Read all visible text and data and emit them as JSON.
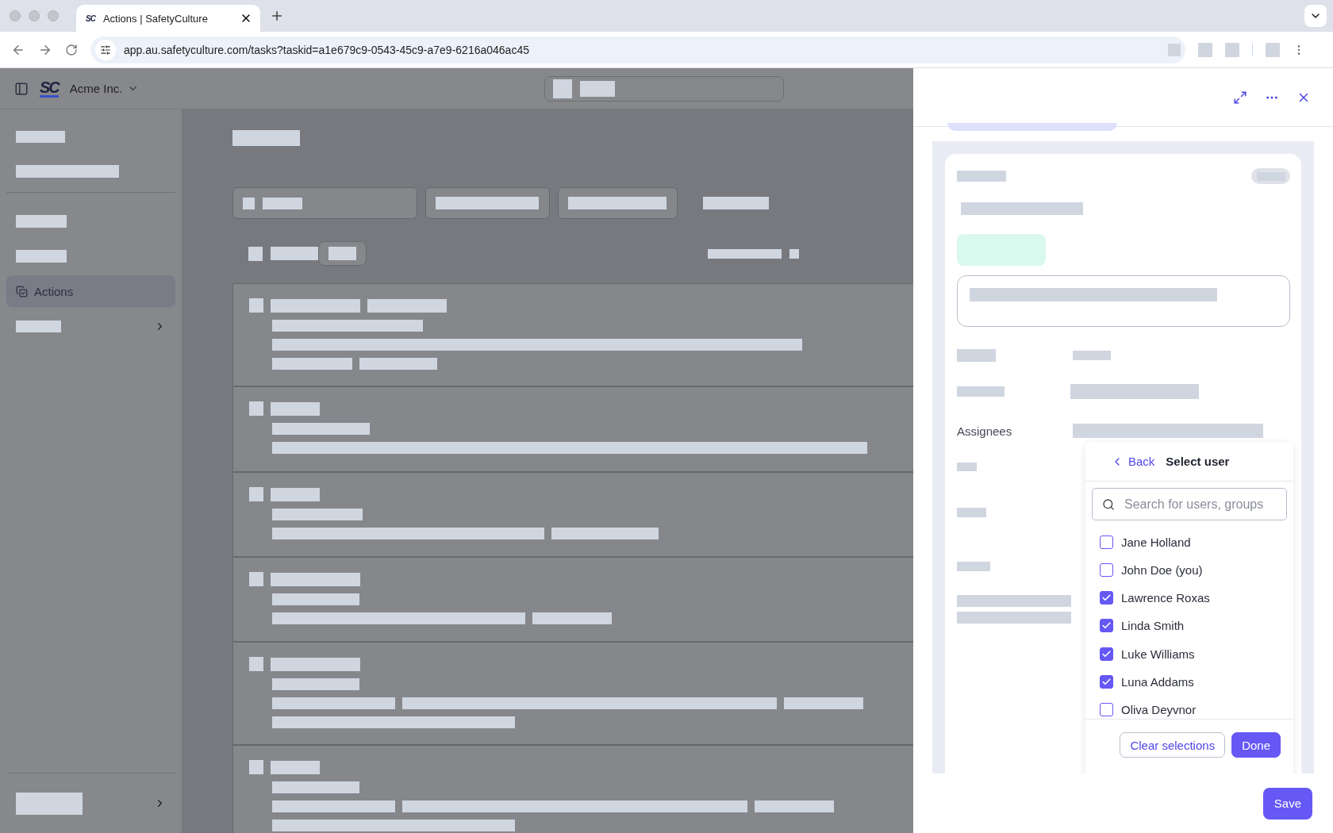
{
  "browser": {
    "tab": {
      "favicon_text": "SC",
      "title": "Actions | SafetyCulture"
    },
    "url": "app.au.safetyculture.com/tasks?taskid=a1e679c9-0543-45c9-a7e9-6216a046ac45"
  },
  "app_header": {
    "logo_text": "SC",
    "org_name": "Acme Inc."
  },
  "sidebar": {
    "items": [
      {
        "label": "Actions",
        "selected": true
      }
    ]
  },
  "detail_panel": {
    "field_label": "Assignees",
    "user_picker": {
      "back_label": "Back",
      "title": "Select user",
      "search": {
        "placeholder": "Search for users, groups"
      },
      "users": [
        {
          "name": "Jane Holland",
          "checked": false
        },
        {
          "name": "John Doe (you)",
          "checked": false
        },
        {
          "name": "Lawrence Roxas",
          "checked": true
        },
        {
          "name": "Linda Smith",
          "checked": true
        },
        {
          "name": "Luke Williams",
          "checked": true
        },
        {
          "name": "Luna Addams",
          "checked": true
        },
        {
          "name": "Oliva Deyvnor",
          "checked": false
        }
      ],
      "buttons": [
        {
          "label": "Clear selections",
          "kind": "secondary"
        },
        {
          "label": "Done",
          "kind": "primary"
        }
      ]
    },
    "save_button": "Save"
  }
}
